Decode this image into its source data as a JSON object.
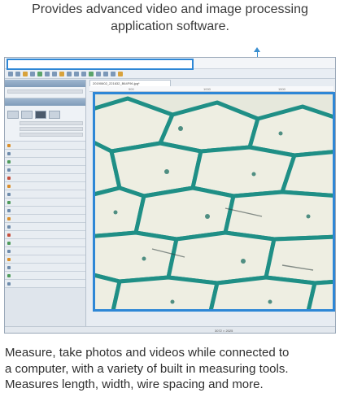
{
  "caption_top": {
    "line1": "Provides advanced video and image processing",
    "line2": "application software."
  },
  "caption_bottom": {
    "line1": "Measure, take photos and videos while connected to",
    "line2": "a computer, with a variety of built in measuring tools.",
    "line3": "Measures length, width, wire spacing and more."
  },
  "document": {
    "tab_title": "20190602_221632_B64F96.jpg*"
  },
  "ruler": {
    "ticks": [
      "500",
      "1000",
      "1500"
    ]
  },
  "statusbar": {
    "dims": "3072 × 2025"
  },
  "colors": {
    "accent": "#2e87d6",
    "cell_wall": "#1f8f86",
    "cell_fill": "#ecebdc"
  }
}
